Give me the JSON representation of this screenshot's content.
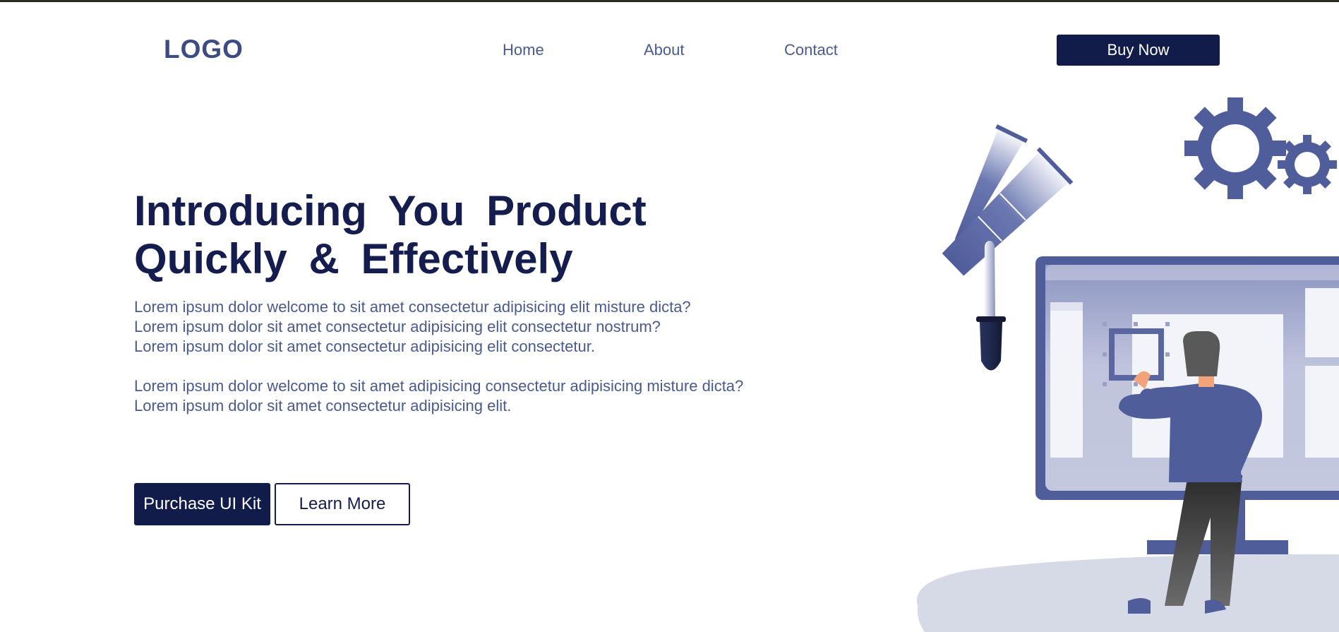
{
  "header": {
    "logo": "LOGO",
    "nav": [
      "Home",
      "About",
      "Contact"
    ],
    "buy_label": "Buy Now"
  },
  "hero": {
    "headline_line1": "Introducing You Product",
    "headline_line2": "Quickly & Effectively",
    "paragraph1_lines": [
      "Lorem ipsum dolor welcome to sit amet consectetur adipisicing elit misture dicta?",
      "Lorem ipsum dolor sit amet consectetur adipisicing elit consectetur nostrum?",
      "Lorem ipsum dolor sit amet consectetur adipisicing elit consectetur."
    ],
    "paragraph2_sentence1": "Lorem ipsum dolor welcome to sit amet adipisicing consectetur adipisicing misture dicta?",
    "paragraph2_sentence2": "Lorem ipsum dolor sit amet consectetur adipisicing elit.",
    "primary_button": "Purchase UI Kit",
    "secondary_button": "Learn More"
  },
  "colors": {
    "navy": "#121c4a",
    "text_blue": "#4a5a8f",
    "illustration_blue": "#4f5d9b",
    "ground": "#d6d9e6"
  },
  "icons": [
    "gear-icon",
    "paint-tube-icon",
    "dropper-icon"
  ]
}
